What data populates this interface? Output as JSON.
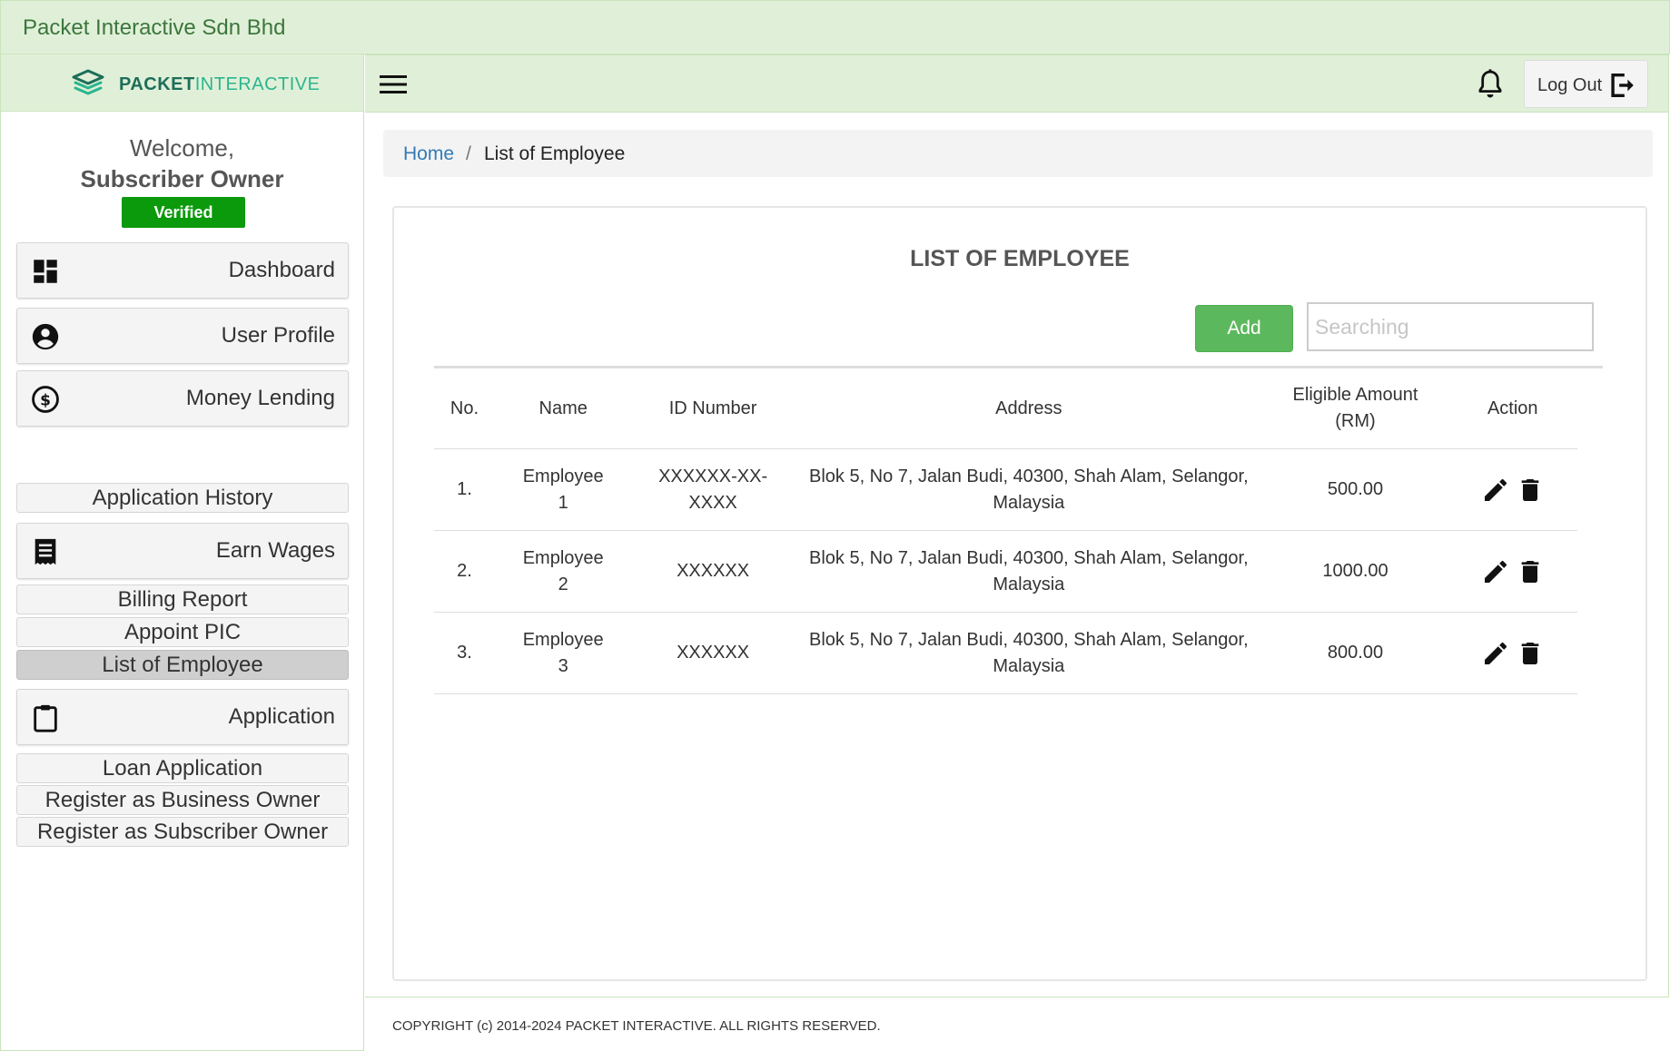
{
  "topbar": {
    "company": "Packet Interactive Sdn Bhd"
  },
  "brand": {
    "bold": "PACKET",
    "light": "INTERACTIVE",
    "logo_icon": "layers-logo-icon"
  },
  "sidebar": {
    "welcome": "Welcome,",
    "user_name": "Subscriber Owner",
    "status_badge": "Verified",
    "menu": {
      "dashboard": {
        "label": "Dashboard",
        "icon": "dashboard-icon"
      },
      "user_profile": {
        "label": "User Profile",
        "icon": "account-circle-icon"
      },
      "money_lending": {
        "label": "Money Lending",
        "icon": "dollar-circle-icon"
      },
      "application_history": {
        "label": "Application History"
      },
      "earn_wages": {
        "label": "Earn Wages",
        "icon": "receipt-icon"
      },
      "billing_report": {
        "label": "Billing Report"
      },
      "appoint_pic": {
        "label": "Appoint PIC"
      },
      "list_of_employee": {
        "label": "List of Employee",
        "active": true
      },
      "application": {
        "label": "Application",
        "icon": "clipboard-icon"
      },
      "loan_application": {
        "label": "Loan Application"
      },
      "register_business_owner": {
        "label": "Register as Business Owner"
      },
      "register_subscriber_owner": {
        "label": "Register as Subscriber Owner"
      }
    }
  },
  "header": {
    "menu_icon": "hamburger-menu-icon",
    "notification_icon": "bell-icon",
    "logout_label": "Log Out",
    "logout_icon": "logout-icon"
  },
  "breadcrumb": {
    "home": "Home",
    "separator": "/",
    "current": "List of Employee"
  },
  "card": {
    "title": "LIST OF EMPLOYEE",
    "add_label": "Add",
    "search_placeholder": "Searching",
    "search_value": ""
  },
  "table": {
    "columns": {
      "no": "No.",
      "name": "Name",
      "id_number": "ID Number",
      "address": "Address",
      "amount_line1": "Eligible Amount",
      "amount_line2": "(RM)",
      "action": "Action"
    },
    "rows": [
      {
        "no": "1.",
        "name_line1": "Employee",
        "name_line2": "1",
        "id_line1": "XXXXXX-XX-",
        "id_line2": "XXXX",
        "address_line1": "Blok 5, No 7, Jalan Budi, 40300, Shah Alam, Selangor,",
        "address_line2": "Malaysia",
        "amount": "500.00"
      },
      {
        "no": "2.",
        "name_line1": "Employee",
        "name_line2": "2",
        "id_line1": "XXXXXX",
        "id_line2": "",
        "address_line1": "Blok 5, No 7, Jalan Budi, 40300, Shah Alam, Selangor,",
        "address_line2": "Malaysia",
        "amount": "1000.00"
      },
      {
        "no": "3.",
        "name_line1": "Employee",
        "name_line2": "3",
        "id_line1": "XXXXXX",
        "id_line2": "",
        "address_line1": "Blok 5, No 7, Jalan Budi, 40300, Shah Alam, Selangor,",
        "address_line2": "Malaysia",
        "amount": "800.00"
      }
    ],
    "edit_icon": "pencil-edit-icon",
    "delete_icon": "trash-delete-icon"
  },
  "footer": {
    "copyright": "COPYRIGHT (c) 2014-2024 PACKET INTERACTIVE. ALL RIGHTS RESERVED."
  },
  "colors": {
    "header_bg": "#e0f0d8",
    "company_text": "#3c763d",
    "verified_bg": "#0b9a0b",
    "add_button": "#5cb85c",
    "link": "#337ab7",
    "active_menu_bg": "#cfcfcf"
  }
}
